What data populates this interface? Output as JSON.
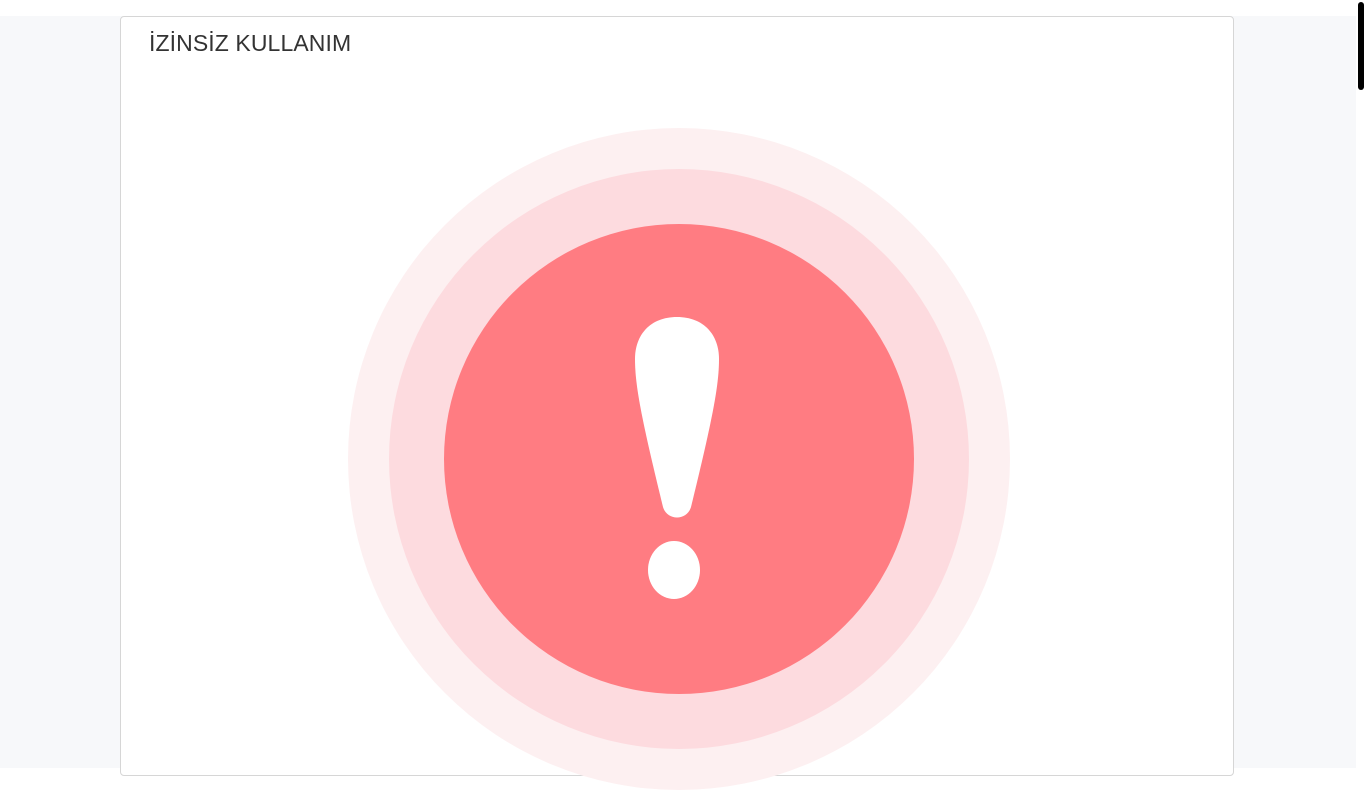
{
  "card": {
    "title": "İZİNSİZ KULLANIM"
  },
  "icon": {
    "name": "exclamation-icon",
    "colors": {
      "outer_ring": "#fdf0f1",
      "middle_ring": "#fddbdf",
      "inner_circle": "#ff7c82",
      "glyph": "#ffffff"
    }
  },
  "theme": {
    "page_background": "#f7f8fa",
    "card_background": "#ffffff",
    "card_border": "#d6d6d6",
    "title_color": "#333333"
  }
}
